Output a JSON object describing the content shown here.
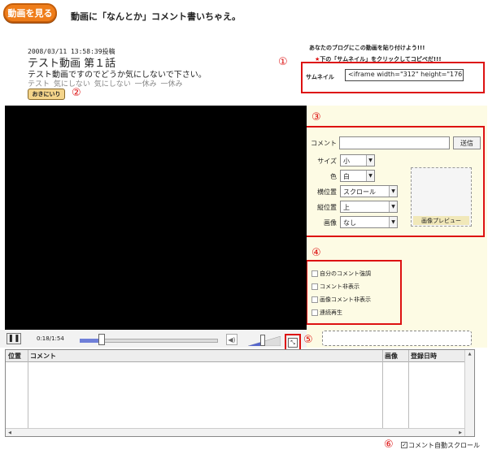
{
  "header": {
    "logo_text": "動画を見る",
    "tagline": "動画に「なんとか」コメント書いちゃえ。"
  },
  "video_info": {
    "posted": "2008/03/11 13:58:39投稿",
    "title": "テスト動画 第１話",
    "description": "テスト動画ですのでどうか気にしないで下さい。",
    "tags": "テスト 気にしない 気にしない 一休み 一休み",
    "favorite_label": "おきにいり"
  },
  "markers": {
    "m1": "①",
    "m2": "②",
    "m3": "③",
    "m4": "④",
    "m5": "⑤",
    "m6": "⑥"
  },
  "embed": {
    "line1": "あなたのブログにこの動画を貼り付けよう!!!",
    "line2": "下の「サムネイル」をクリックしてコピペだ!!!",
    "star": "★",
    "thumbnail_label": "サムネイル",
    "code": "<iframe width=\"312\" height=\"176\""
  },
  "comment_form": {
    "comment_label": "コメント",
    "comment_value": "",
    "send_label": "送信",
    "size_label": "サイズ",
    "size_value": "小",
    "color_label": "色",
    "color_value": "白",
    "hpos_label": "横位置",
    "hpos_value": "スクロール",
    "vpos_label": "縦位置",
    "vpos_value": "上",
    "image_label": "画像",
    "image_value": "なし",
    "preview_label": "画像プレビュー"
  },
  "options": [
    {
      "label": "自分のコメント強調",
      "checked": false
    },
    {
      "label": "コメント非表示",
      "checked": false
    },
    {
      "label": "画像コメント非表示",
      "checked": false
    },
    {
      "label": "連続再生",
      "checked": false
    }
  ],
  "player": {
    "pause_icon": "❚❚",
    "time": "0:18/1:54",
    "progress_fraction": 0.16,
    "volume_fraction": 0.45,
    "fullscreen_icon": "⤡",
    "volume_icon": "◀)"
  },
  "table": {
    "columns": [
      "位置",
      "コメント",
      "画像",
      "登録日時"
    ],
    "rows": []
  },
  "autoscroll": {
    "label": "コメント自動スクロール",
    "checked": true,
    "check_glyph": "✓"
  },
  "colors": {
    "accent_red": "#dd1111",
    "logo_orange": "#ef7d1a",
    "panel_bg": "#fdfbe4",
    "seek_fill": "#6f7fd8"
  }
}
